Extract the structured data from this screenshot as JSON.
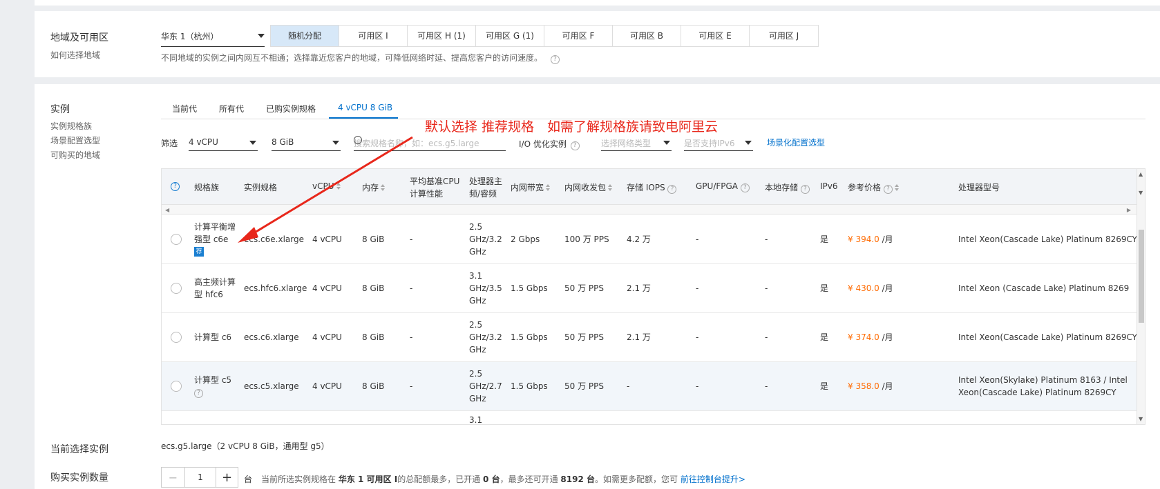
{
  "region": {
    "title": "地域及可用区",
    "help_link": "如何选择地域",
    "selected_region": "华东 1（杭州）",
    "zones": [
      "随机分配",
      "可用区 I",
      "可用区 H (1)",
      "可用区 G (1)",
      "可用区 F",
      "可用区 B",
      "可用区 E",
      "可用区 J"
    ],
    "selected_zone": "随机分配",
    "note": "不同地域的实例之间内网互不相通；选择靠近您客户的地域，可降低网络时延、提高您客户的访问速度。"
  },
  "instance": {
    "title": "实例",
    "links": [
      "实例规格族",
      "场景配置选型",
      "可购买的地域"
    ],
    "tabs": [
      "当前代",
      "所有代",
      "已购实例规格",
      "4 vCPU 8 GiB"
    ],
    "active_tab": "4 vCPU 8 GiB",
    "filter_label": "筛选",
    "filter_vcpu": "4 vCPU",
    "filter_mem": "8 GiB",
    "search_placeholder": "搜索规格名称，如：ecs.g5.large",
    "io_label": "I/O 优化实例",
    "network_type_placeholder": "选择网络类型",
    "ipv6_placeholder": "是否支持IPv6",
    "scene_link": "场景化配置选型"
  },
  "annotation": "默认选择 推荐规格　如需了解规格族请致电阿里云",
  "table": {
    "headers": {
      "family": "规格族",
      "spec": "实例规格",
      "vcpu": "vCPU",
      "memory": "内存",
      "baseline_1": "平均基准CPU",
      "baseline_2": "计算性能",
      "freq_1": "处理器主",
      "freq_2": "频/睿频",
      "bandwidth": "内网带宽",
      "pps": "内网收发包",
      "iops": "存储 IOPS",
      "gpu": "GPU/FPGA",
      "local_storage": "本地存储",
      "ipv6": "IPv6",
      "price": "参考价格",
      "cpu_model": "处理器型号"
    },
    "rows": [
      {
        "family_1": "计算平衡增",
        "family_2": "强型 c6e",
        "badge": "荐",
        "spec": "ecs.c6e.xlarge",
        "vcpu": "4 vCPU",
        "memory": "8 GiB",
        "baseline": "-",
        "freq_1": "2.5",
        "freq_2": "GHz/3.2",
        "freq_3": "GHz",
        "bandwidth": "2 Gbps",
        "pps": "100 万 PPS",
        "iops": "4.2 万",
        "gpu": "-",
        "local": "-",
        "ipv6": "是",
        "price": "¥ 394.0",
        "unit": "/月",
        "cpu_1": "Intel Xeon(Cascade Lake) Platinum 8269CY",
        "cpu_2": ""
      },
      {
        "family_1": "高主频计算",
        "family_2": "型 hfc6",
        "badge": "",
        "spec": "ecs.hfc6.xlarge",
        "vcpu": "4 vCPU",
        "memory": "8 GiB",
        "baseline": "-",
        "freq_1": "3.1",
        "freq_2": "GHz/3.5",
        "freq_3": "GHz",
        "bandwidth": "1.5 Gbps",
        "pps": "50 万 PPS",
        "iops": "2.1 万",
        "gpu": "-",
        "local": "-",
        "ipv6": "是",
        "price": "¥ 430.0",
        "unit": "/月",
        "cpu_1": "Intel Xeon (Cascade Lake) Platinum 8269",
        "cpu_2": ""
      },
      {
        "family_1": "计算型 c6",
        "family_2": "",
        "badge": "",
        "spec": "ecs.c6.xlarge",
        "vcpu": "4 vCPU",
        "memory": "8 GiB",
        "baseline": "-",
        "freq_1": "2.5",
        "freq_2": "GHz/3.2",
        "freq_3": "GHz",
        "bandwidth": "1.5 Gbps",
        "pps": "50 万 PPS",
        "iops": "2.1 万",
        "gpu": "-",
        "local": "-",
        "ipv6": "是",
        "price": "¥ 374.0",
        "unit": "/月",
        "cpu_1": "Intel Xeon(Cascade Lake) Platinum 8269CY",
        "cpu_2": ""
      },
      {
        "family_1": "计算型 c5",
        "family_2": "",
        "badge": "",
        "spec": "ecs.c5.xlarge",
        "vcpu": "4 vCPU",
        "memory": "8 GiB",
        "baseline": "-",
        "freq_1": "2.5",
        "freq_2": "GHz/2.7",
        "freq_3": "GHz",
        "bandwidth": "1.5 Gbps",
        "pps": "50 万 PPS",
        "iops": "-",
        "gpu": "-",
        "local": "-",
        "ipv6": "是",
        "price": "¥ 358.0",
        "unit": "/月",
        "cpu_1": "Intel Xeon(Skylake) Platinum 8163 / Intel",
        "cpu_2": "Xeon(Cascade Lake) Platinum 8269CY"
      }
    ],
    "partial_row_freq": "3.1"
  },
  "current": {
    "label": "当前选择实例",
    "value": "ecs.g5.large（2 vCPU 8 GiB，通用型 g5）"
  },
  "quantity": {
    "label": "购买实例数量",
    "minus": "−",
    "value": "1",
    "plus": "+",
    "unit": "台",
    "note_pre": "当前所选实例规格在",
    "note_region": "华东 1 可用区 I",
    "note_mid": "的总配额最多，已开通",
    "note_open": "0 台",
    "note_max_pre": "，最多还可开通",
    "note_max": "8192 台",
    "note_post": "。如需更多配额，您可",
    "note_link": "前往控制台提升>"
  }
}
